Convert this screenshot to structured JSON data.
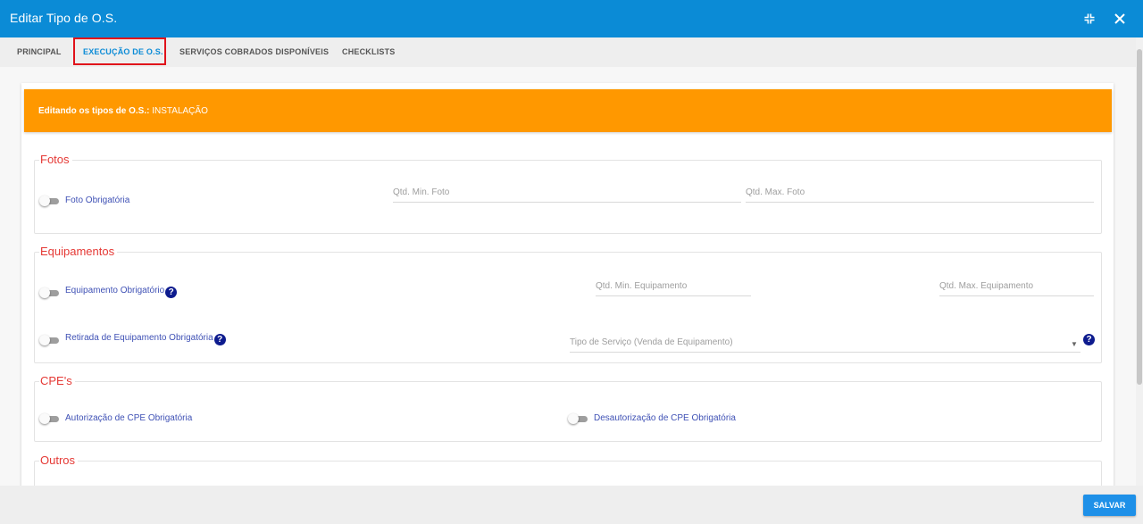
{
  "window": {
    "title": "Editar Tipo de O.S."
  },
  "tabs": [
    {
      "label": "PRINCIPAL"
    },
    {
      "label": "EXECUÇÃO DE O.S."
    },
    {
      "label": "SERVIÇOS COBRADOS DISPONÍVEIS"
    },
    {
      "label": "CHECKLISTS"
    }
  ],
  "active_tab": "EXECUÇÃO DE O.S.",
  "banner": {
    "prefix": "Editando os tipos de O.S.:",
    "value": "INSTALAÇÃO"
  },
  "sections": {
    "fotos": {
      "title": "Fotos",
      "toggle_label": "Foto Obrigatória",
      "min_placeholder": "Qtd. Min. Foto",
      "max_placeholder": "Qtd. Max. Foto"
    },
    "equipamentos": {
      "title": "Equipamentos",
      "toggle_label": "Equipamento Obrigatório",
      "min_placeholder": "Qtd. Min. Equipamento",
      "max_placeholder": "Qtd. Max. Equipamento",
      "retirada_label": "Retirada de Equipamento Obrigatória",
      "tipo_servico_placeholder": "Tipo de Serviço (Venda de Equipamento)"
    },
    "cpes": {
      "title": "CPE's",
      "autorizacao_label": "Autorização de CPE Obrigatória",
      "desautorizacao_label": "Desautorização de CPE Obrigatória"
    },
    "outros": {
      "title": "Outros"
    }
  },
  "footer": {
    "save_label": "SALVAR"
  },
  "icons": {
    "help": "?",
    "close": "✕"
  },
  "colors": {
    "header": "#0b8bd6",
    "banner": "#ff9800",
    "section_title": "#e53935",
    "label": "#3f51b5",
    "save_button": "#1e90e8"
  }
}
